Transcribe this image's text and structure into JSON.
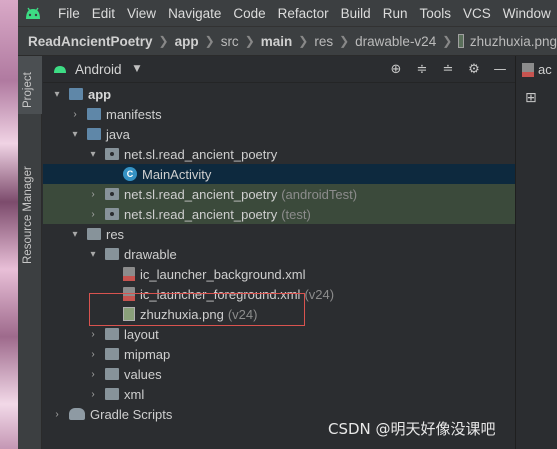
{
  "menu": [
    "File",
    "Edit",
    "View",
    "Navigate",
    "Code",
    "Refactor",
    "Build",
    "Run",
    "Tools",
    "VCS",
    "Window"
  ],
  "breadcrumb": [
    "ReadAncientPoetry",
    "app",
    "src",
    "main",
    "res",
    "drawable-v24",
    "zhuzhuxia.png"
  ],
  "side_tabs": {
    "project": "Project",
    "resource_manager": "Resource Manager"
  },
  "panel": {
    "title": "Android"
  },
  "tree": [
    {
      "label": "app",
      "indent": 0,
      "arrow": "▾",
      "icon": "module-folder",
      "suffix": ""
    },
    {
      "label": "manifests",
      "indent": 1,
      "arrow": "›",
      "icon": "folder-blue",
      "suffix": ""
    },
    {
      "label": "java",
      "indent": 1,
      "arrow": "▾",
      "icon": "folder-blue",
      "suffix": ""
    },
    {
      "label": "net.sl.read_ancient_poetry",
      "indent": 2,
      "arrow": "▾",
      "icon": "package",
      "suffix": ""
    },
    {
      "label": "MainActivity",
      "indent": 3,
      "arrow": "",
      "icon": "class",
      "suffix": ""
    },
    {
      "label": "net.sl.read_ancient_poetry",
      "indent": 2,
      "arrow": "›",
      "icon": "package",
      "suffix": "(androidTest)"
    },
    {
      "label": "net.sl.read_ancient_poetry",
      "indent": 2,
      "arrow": "›",
      "icon": "package",
      "suffix": "(test)"
    },
    {
      "label": "res",
      "indent": 1,
      "arrow": "▾",
      "icon": "folder",
      "suffix": ""
    },
    {
      "label": "drawable",
      "indent": 2,
      "arrow": "▾",
      "icon": "folder",
      "suffix": ""
    },
    {
      "label": "ic_launcher_background.xml",
      "indent": 3,
      "arrow": "",
      "icon": "xml",
      "suffix": ""
    },
    {
      "label": "ic_launcher_foreground.xml",
      "indent": 3,
      "arrow": "",
      "icon": "xml",
      "suffix": "(v24)"
    },
    {
      "label": "zhuzhuxia.png",
      "indent": 3,
      "arrow": "",
      "icon": "png",
      "suffix": "(v24)"
    },
    {
      "label": "layout",
      "indent": 2,
      "arrow": "›",
      "icon": "folder",
      "suffix": ""
    },
    {
      "label": "mipmap",
      "indent": 2,
      "arrow": "›",
      "icon": "folder",
      "suffix": ""
    },
    {
      "label": "values",
      "indent": 2,
      "arrow": "›",
      "icon": "folder",
      "suffix": ""
    },
    {
      "label": "xml",
      "indent": 2,
      "arrow": "›",
      "icon": "folder",
      "suffix": ""
    },
    {
      "label": "Gradle Scripts",
      "indent": 0,
      "arrow": "›",
      "icon": "gradle",
      "suffix": ""
    }
  ],
  "selected_row": "MainActivity",
  "editor": {
    "tab_label": "ac"
  },
  "watermark": "CSDN @明天好像没课吧",
  "colors": {
    "selection": "#0d293e",
    "test_highlight": "#3b4a3b",
    "annotation": "#d9534f"
  }
}
